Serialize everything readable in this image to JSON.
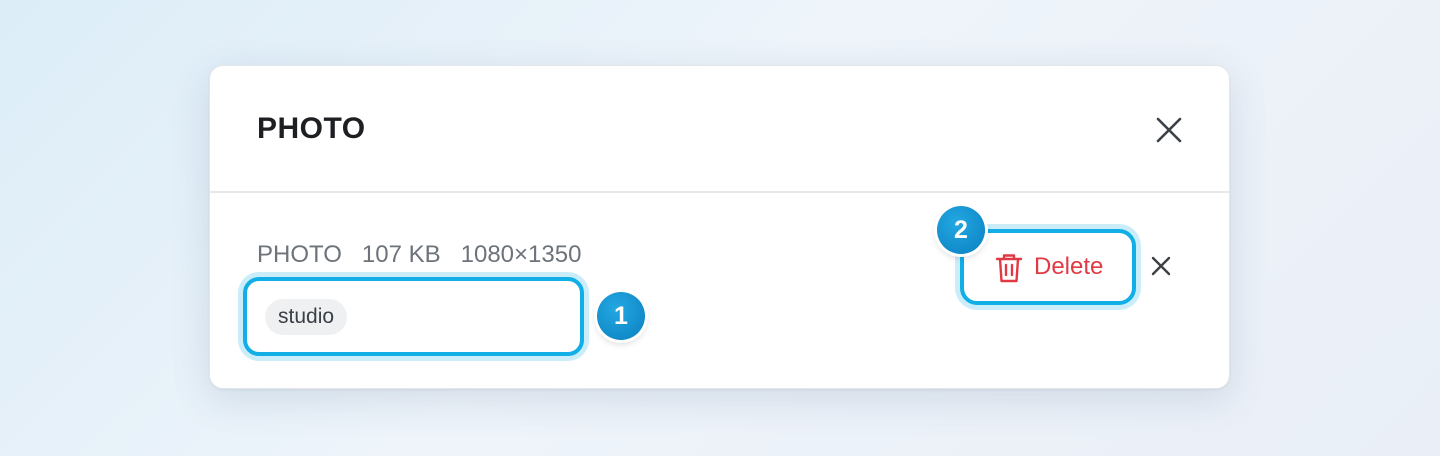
{
  "dialog": {
    "title": "PHOTO",
    "close_icon": "close-icon"
  },
  "file": {
    "type": "PHOTO",
    "size": "107 KB",
    "dimensions": "1080×1350"
  },
  "tags": {
    "chips": [
      "studio"
    ]
  },
  "annotations": {
    "badge1": "1",
    "badge2": "2"
  },
  "actions": {
    "delete_label": "Delete",
    "delete_icon": "trash-icon",
    "dismiss_icon": "close-icon"
  },
  "colors": {
    "accent": "#12aee6",
    "danger": "#e23a45",
    "badge": "#0a7fbf"
  }
}
